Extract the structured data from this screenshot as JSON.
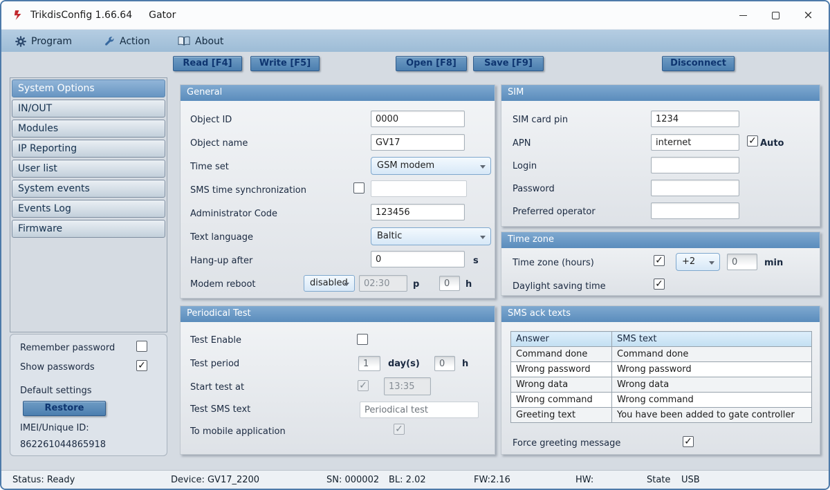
{
  "window": {
    "title": "TrikdisConfig 1.66.64",
    "subtitle": "Gator",
    "close_glyph": "×"
  },
  "icons": {
    "check": "✓"
  },
  "menu": {
    "program": "Program",
    "action": "Action",
    "about": "About"
  },
  "toolbar": {
    "read": "Read [F4]",
    "write": "Write [F5]",
    "open": "Open [F8]",
    "save": "Save [F9]",
    "disconnect": "Disconnect"
  },
  "sidebar": {
    "items": [
      {
        "label": "System Options",
        "selected": true
      },
      {
        "label": "IN/OUT",
        "selected": false
      },
      {
        "label": "Modules",
        "selected": false
      },
      {
        "label": "IP Reporting",
        "selected": false
      },
      {
        "label": "User list",
        "selected": false
      },
      {
        "label": "System events",
        "selected": false
      },
      {
        "label": "Events Log",
        "selected": false
      },
      {
        "label": "Firmware",
        "selected": false
      }
    ],
    "options": {
      "remember_password_label": "Remember password",
      "remember_password_checked": false,
      "show_passwords_label": "Show passwords",
      "show_passwords_checked": true,
      "default_settings_label": "Default settings",
      "restore_label": "Restore",
      "imei_label": "IMEI/Unique ID:",
      "imei_value": "862261044865918"
    }
  },
  "general": {
    "title": "General",
    "object_id_label": "Object ID",
    "object_id_value": "0000",
    "object_name_label": "Object name",
    "object_name_value": "GV17",
    "time_set_label": "Time set",
    "time_set_value": "GSM modem",
    "sms_time_sync_label": "SMS time synchronization",
    "sms_time_sync_checked": false,
    "sms_time_sync_value": "",
    "admin_code_label": "Administrator Code",
    "admin_code_value": "123456",
    "text_language_label": "Text language",
    "text_language_value": "Baltic",
    "hangup_label": "Hang-up after",
    "hangup_value": "0",
    "hangup_unit": "s",
    "modem_reboot_label": "Modem reboot",
    "modem_reboot_mode": "disabled",
    "modem_reboot_time": "02:30",
    "modem_reboot_p_unit": "p",
    "modem_reboot_hours": "0",
    "modem_reboot_h_unit": "h"
  },
  "periodical_test": {
    "title": "Periodical Test",
    "test_enable_label": "Test Enable",
    "test_enable_checked": false,
    "test_period_label": "Test period",
    "test_period_days": "1",
    "days_unit": "day(s)",
    "test_period_hours": "0",
    "hours_unit": "h",
    "start_test_label": "Start test at",
    "start_test_checked": true,
    "start_test_time": "13:35",
    "test_sms_label": "Test SMS text",
    "test_sms_value": "Periodical test",
    "to_mobile_label": "To mobile application",
    "to_mobile_checked": true
  },
  "sim": {
    "title": "SIM",
    "pin_label": "SIM card pin",
    "pin_value": "1234",
    "apn_label": "APN",
    "apn_value": "internet",
    "auto_label": "Auto",
    "auto_checked": true,
    "login_label": "Login",
    "login_value": "",
    "password_label": "Password",
    "password_value": "",
    "operator_label": "Preferred operator",
    "operator_value": ""
  },
  "time_zone": {
    "title": "Time zone",
    "tz_label": "Time zone (hours)",
    "tz_checked": true,
    "tz_value": "+2",
    "tz_min_value": "0",
    "min_unit": "min",
    "dst_label": "Daylight saving time",
    "dst_checked": true
  },
  "sms_ack": {
    "title": "SMS ack texts",
    "columns": [
      "Answer",
      "SMS text"
    ],
    "rows": [
      [
        "Command done",
        "Command done"
      ],
      [
        "Wrong password",
        "Wrong password"
      ],
      [
        "Wrong data",
        "Wrong data"
      ],
      [
        "Wrong command",
        "Wrong command"
      ],
      [
        "Greeting text",
        "You have been added to gate controller"
      ]
    ],
    "force_greeting_label": "Force greeting message",
    "force_greeting_checked": true
  },
  "status_bar": {
    "status": "Status: Ready",
    "device": "Device: GV17_2200",
    "sn": "SN: 000002",
    "bl": "BL: 2.02",
    "fw": "FW:2.16",
    "hw": "HW:",
    "state": "State",
    "usb": "USB"
  }
}
